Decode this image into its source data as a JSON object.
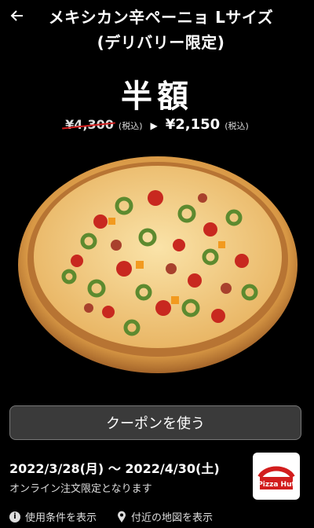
{
  "header": {
    "back_icon": "arrow-left-icon",
    "title_line1": "メキシカン辛ペーニョ Lサイズ",
    "title_line2": "(デリバリー限定)"
  },
  "promo": {
    "headline": "半額",
    "original_price": "¥4,300",
    "original_tax": "(税込)",
    "arrow": "▶",
    "sale_price": "¥2,150",
    "sale_tax": "(税込)"
  },
  "coupon_button": "クーポンを使う",
  "validity": {
    "dates": "2022/3/28(月) 〜 2022/4/30(土)",
    "note": "オンライン注文限定となります"
  },
  "logo_text": "Pizza Hut",
  "footer": {
    "terms_link": "使用条件を表示",
    "map_link": "付近の地図を表示"
  }
}
